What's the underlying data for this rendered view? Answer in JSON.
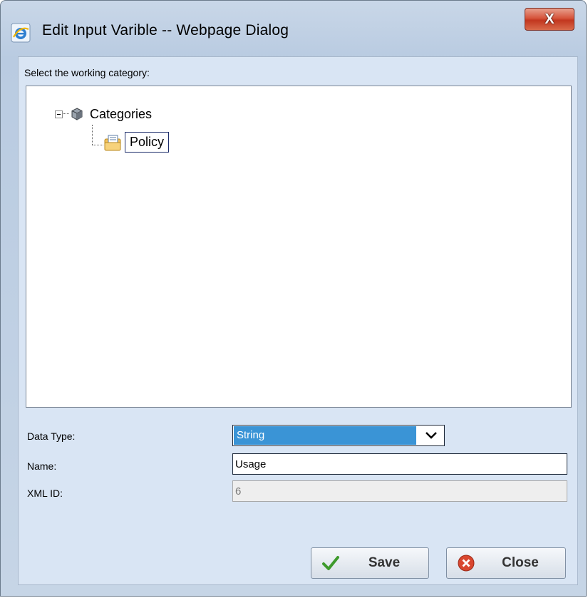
{
  "window": {
    "title": "Edit Input Varible -- Webpage Dialog",
    "close_glyph": "X"
  },
  "tree": {
    "heading": "Select the working category:",
    "root_label": "Categories",
    "child_label": "Policy"
  },
  "form": {
    "data_type_label": "Data Type:",
    "data_type_value": "String",
    "name_label": "Name:",
    "name_value": "Usage",
    "xml_id_label": "XML ID:",
    "xml_id_value": "6"
  },
  "buttons": {
    "save_label": "Save",
    "close_label": "Close"
  },
  "colors": {
    "selection": "#3a94d6",
    "window_frame": "#c9d7e8",
    "close_button": "#c2361f"
  }
}
